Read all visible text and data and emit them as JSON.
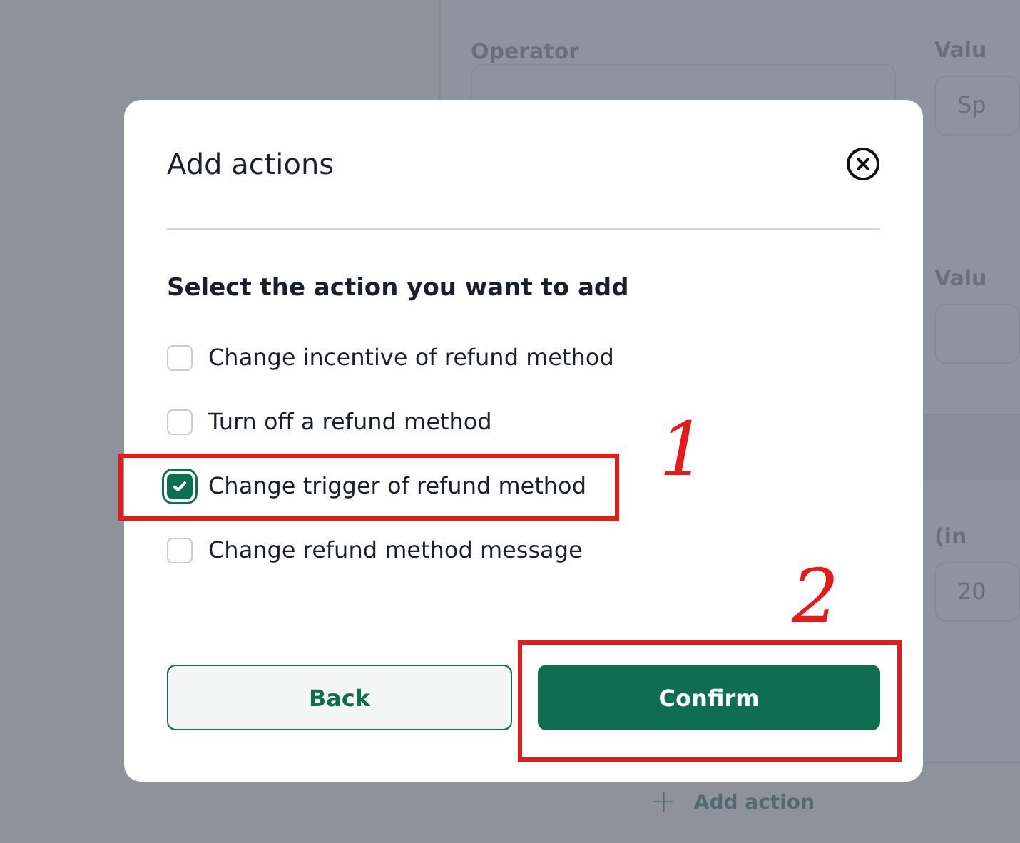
{
  "background": {
    "rows": [
      {
        "left": {
          "label": "Operator"
        },
        "right": {
          "label": "Valu",
          "value": "Sp"
        }
      },
      {
        "right": {
          "label": "Valu"
        }
      },
      {
        "right": {
          "label": "(in",
          "value": "20"
        }
      }
    ],
    "add_action": {
      "icon": "+",
      "label": "Add action"
    }
  },
  "dialog": {
    "title": "Add actions",
    "subtitle": "Select the action you want to add",
    "options": [
      {
        "label": "Change incentive of refund method",
        "checked": false
      },
      {
        "label": "Turn off a refund method",
        "checked": false
      },
      {
        "label": "Change trigger of refund method",
        "checked": true
      },
      {
        "label": "Change refund method message",
        "checked": false
      }
    ],
    "buttons": [
      {
        "label": "Back",
        "kind": "secondary"
      },
      {
        "label": "Confirm",
        "kind": "primary"
      }
    ]
  },
  "annotations": [
    {
      "label": "1"
    },
    {
      "label": "2"
    }
  ]
}
